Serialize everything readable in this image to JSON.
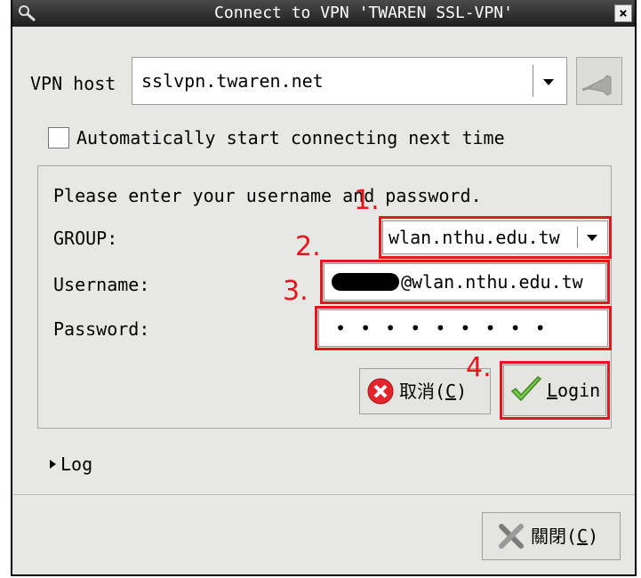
{
  "window": {
    "title": "Connect to VPN 'TWAREN SSL-VPN'",
    "close_glyph": "×"
  },
  "vpn": {
    "host_label": "VPN host",
    "host_value": "sslvpn.twaren.net"
  },
  "auto_connect": {
    "label": "Automatically start connecting next time",
    "checked": false
  },
  "login_group": {
    "prompt": "Please enter your username and password.",
    "group_label": "GROUP:",
    "group_value": "wlan.nthu.edu.tw",
    "username_label": "Username:",
    "username_suffix": "@wlan.nthu.edu.tw",
    "password_label": "Password:",
    "password_value": "• • • • • • • • •",
    "cancel_label": "取消(",
    "cancel_mnemonic": "C",
    "cancel_close": ")",
    "login_mnemonic": "L",
    "login_rest": "ogin"
  },
  "log": {
    "label": "Log"
  },
  "footer": {
    "close_label": "關閉(",
    "close_mnemonic": "C",
    "close_close": ")"
  },
  "annotations": [
    "1.",
    "2.",
    "3.",
    "4."
  ],
  "colors": {
    "annotation": "#e8141e",
    "titlebar": "#2e2e2e",
    "dialog_bg": "#e7e7e4"
  },
  "icons": [
    "key-icon",
    "window-close-icon",
    "chevron-down-icon",
    "connect-plug-icon",
    "cancel-x-icon",
    "checkmark-icon",
    "close-x-icon",
    "expander-triangle-icon"
  ]
}
